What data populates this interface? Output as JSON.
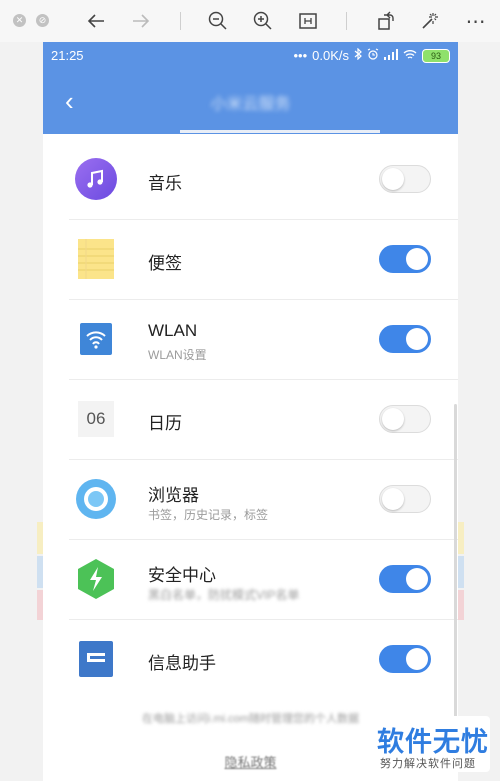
{
  "viewer": {
    "icons": [
      "close-icon",
      "minimize-icon",
      "back-arrow-icon",
      "forward-arrow-icon",
      "zoom-out-icon",
      "zoom-in-icon",
      "fit-page-icon",
      "rotate-icon",
      "magic-wand-icon",
      "more-icon"
    ]
  },
  "status_bar": {
    "time": "21:25",
    "dots": "•••",
    "speed": "0.0K/s",
    "battery": "93"
  },
  "header": {
    "back_glyph": "‹",
    "title": "小米云服务"
  },
  "services": [
    {
      "icon": "music-icon",
      "title": "音乐",
      "subtitle": "",
      "enabled": false
    },
    {
      "icon": "notes-icon",
      "title": "便签",
      "subtitle": "",
      "enabled": true
    },
    {
      "icon": "wlan-icon",
      "title": "WLAN",
      "subtitle": "WLAN设置",
      "enabled": true
    },
    {
      "icon": "calendar-icon",
      "title": "日历",
      "subtitle": "",
      "enabled": false,
      "calendar_day": "06"
    },
    {
      "icon": "browser-icon",
      "title": "浏览器",
      "subtitle": "书签，历史记录，标签",
      "enabled": false
    },
    {
      "icon": "security-center-icon",
      "title": "安全中心",
      "subtitle": "黑白名单，防扰模式VIP名单",
      "enabled": true
    },
    {
      "icon": "info-assistant-icon",
      "title": "信息助手",
      "subtitle": "",
      "enabled": true
    }
  ],
  "footer": {
    "note": "在电脑上访问i.mi.com随时管理您的个人数据",
    "privacy_link": "隐私政策"
  },
  "watermark": {
    "title": "软件无忧",
    "subtitle": "努力解决软件问题"
  },
  "colors": {
    "accent": "#3f86e8",
    "header": "#5b93e4",
    "watermark": "#2f7de0"
  }
}
